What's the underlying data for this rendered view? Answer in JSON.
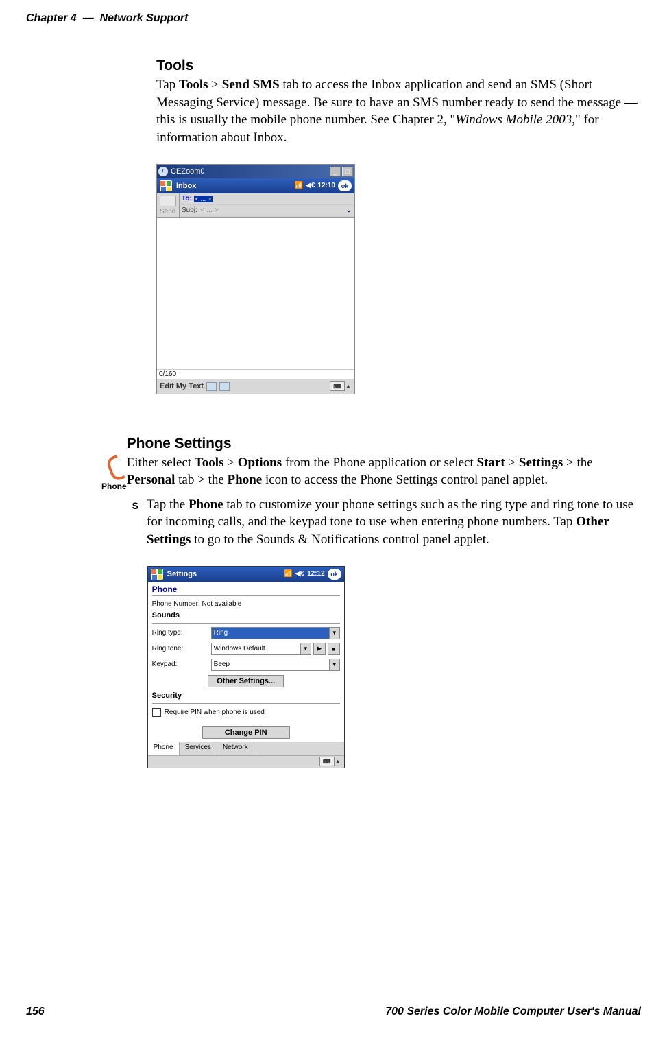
{
  "header": {
    "chapter": "Chapter 4",
    "dash": "—",
    "title": "Network Support"
  },
  "tools": {
    "heading": "Tools",
    "tap": "Tap ",
    "tools_word": "Tools",
    "gt": " > ",
    "send_sms": "Send SMS",
    "para1_rest": " tab to access the Inbox application and send an SMS (Short Messaging Service) message. Be sure to have an SMS number ready to send the message — this is usually the mobile phone number. See Chapter 2, \"",
    "wm2003": "Windows Mobile 2003",
    "para1_end": ",\" for information about Inbox."
  },
  "sms_shot": {
    "titlebar": "CEZoom0",
    "appname": "Inbox",
    "time": "12:10",
    "ok": "ok",
    "send": "Send",
    "to": "To:",
    "to_chip": "< ... >",
    "subj": "Subj:",
    "subj_ph": "< ... >",
    "counter": "0/160",
    "edit": "Edit My Text"
  },
  "phone": {
    "heading": "Phone Settings",
    "icon_label": "Phone",
    "para1_a": "Either select ",
    "tools": "Tools",
    "gt1": " > ",
    "options": "Options",
    "para1_b": " from the Phone application or select ",
    "start": "Start",
    "gt2": " > ",
    "settings": "Settings",
    "para1_c": " > the ",
    "personal": "Personal",
    "para1_d": " tab > the ",
    "phone_word": "Phone",
    "para1_e": " icon to access the Phone Settings control panel applet.",
    "bullet_a": "Tap the ",
    "bullet_phone": "Phone",
    "bullet_b": " tab to customize your phone settings such as the ring type and ring tone to use for incoming calls, and the keypad tone to use when entering phone numbers. Tap ",
    "bullet_os": "Other Settings",
    "bullet_c": " to go to the Sounds & Notifications control panel applet."
  },
  "settings_shot": {
    "appname": "Settings",
    "time": "12:12",
    "ok": "ok",
    "phone_link": "Phone",
    "pn_label": "Phone Number:",
    "pn_value": "Not available",
    "sounds": "Sounds",
    "ringtype": "Ring type:",
    "ringtype_val": "Ring",
    "ringtone": "Ring tone:",
    "ringtone_val": "Windows Default",
    "keypad": "Keypad:",
    "keypad_val": "Beep",
    "other": "Other Settings...",
    "security": "Security",
    "pin_cb": "Require PIN when phone is used",
    "changepin": "Change PIN",
    "tab_phone": "Phone",
    "tab_services": "Services",
    "tab_network": "Network"
  },
  "footer": {
    "page": "156",
    "title": "700 Series Color Mobile Computer User's Manual"
  }
}
